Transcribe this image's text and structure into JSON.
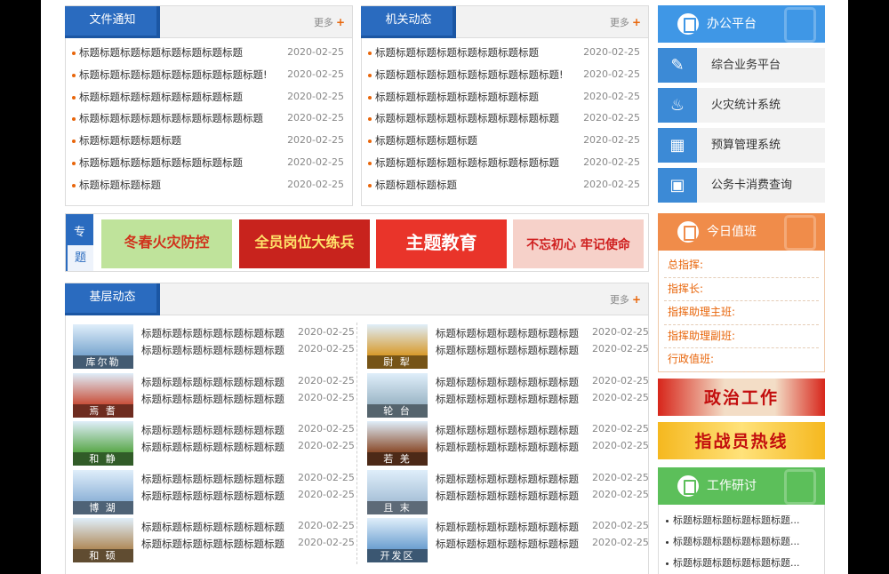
{
  "notice": {
    "tab": "文件通知",
    "more": "更多",
    "items": [
      {
        "title": "标题标题标题标题标题标题标题标题",
        "date": "2020-02-25"
      },
      {
        "title": "标题标题标题标题标题标题标题标题标题!",
        "date": "2020-02-25"
      },
      {
        "title": "标题标题标题标题标题标题标题标题",
        "date": "2020-02-25"
      },
      {
        "title": "标题标题标题标题标题标题标题标题标题",
        "date": "2020-02-25"
      },
      {
        "title": "标题标题标题标题标题",
        "date": "2020-02-25"
      },
      {
        "title": "标题标题标题标题标题标题标题标题",
        "date": "2020-02-25"
      },
      {
        "title": "标题标题标题标题",
        "date": "2020-02-25"
      }
    ]
  },
  "org_news": {
    "tab": "机关动态",
    "more": "更多",
    "items": [
      {
        "title": "标题标题标题标题标题标题标题标题",
        "date": "2020-02-25"
      },
      {
        "title": "标题标题标题标题标题标题标题标题标题!",
        "date": "2020-02-25"
      },
      {
        "title": "标题标题标题标题标题标题标题标题",
        "date": "2020-02-25"
      },
      {
        "title": "标题标题标题标题标题标题标题标题标题",
        "date": "2020-02-25"
      },
      {
        "title": "标题标题标题标题标题",
        "date": "2020-02-25"
      },
      {
        "title": "标题标题标题标题标题标题标题标题标题",
        "date": "2020-02-25"
      },
      {
        "title": "标题标题标题标题",
        "date": "2020-02-25"
      }
    ]
  },
  "topics": {
    "label_1": "专",
    "label_2": "题",
    "banners": [
      {
        "text": "冬春火灾防控",
        "bg": "#bfe39b",
        "color": "#d0321c"
      },
      {
        "text": "全员岗位大练兵",
        "bg": "#c8231d",
        "color": "#ffe36a"
      },
      {
        "text": "主题教育",
        "bg": "#e9342a",
        "color": "#ffffff"
      },
      {
        "text": "不忘初心 牢记使命",
        "bg": "#f6d1c9",
        "color": "#cf1f1f"
      }
    ]
  },
  "grassroots": {
    "tab": "基层动态",
    "more": "更多",
    "items": [
      {
        "caption": "库尔勒",
        "bg": "#7aa6cf",
        "rows": [
          {
            "title": "标题标题标题标题标题标题标题",
            "date": "2020-02-25"
          },
          {
            "title": "标题标题标题标题标题标题标题",
            "date": "2020-02-25"
          }
        ]
      },
      {
        "caption": "尉 犁",
        "bg": "#d89a2b",
        "rows": [
          {
            "title": "标题标题标题标题标题标题标题",
            "date": "2020-02-25"
          },
          {
            "title": "标题标题标题标题标题标题标题",
            "date": "2020-02-25"
          }
        ]
      },
      {
        "caption": "焉 耆",
        "bg": "#c9503b",
        "rows": [
          {
            "title": "标题标题标题标题标题标题标题",
            "date": "2020-02-25"
          },
          {
            "title": "标题标题标题标题标题标题标题",
            "date": "2020-02-25"
          }
        ]
      },
      {
        "caption": "轮 台",
        "bg": "#9cb6c6",
        "rows": [
          {
            "title": "标题标题标题标题标题标题标题",
            "date": "2020-02-25"
          },
          {
            "title": "标题标题标题标题标题标题标题",
            "date": "2020-02-25"
          }
        ]
      },
      {
        "caption": "和 静",
        "bg": "#5aa84a",
        "rows": [
          {
            "title": "标题标题标题标题标题标题标题",
            "date": "2020-02-25"
          },
          {
            "title": "标题标题标题标题标题标题标题",
            "date": "2020-02-25"
          }
        ]
      },
      {
        "caption": "若 羌",
        "bg": "#8a4b2a",
        "rows": [
          {
            "title": "标题标题标题标题标题标题标题",
            "date": "2020-02-25"
          },
          {
            "title": "标题标题标题标题标题标题标题",
            "date": "2020-02-25"
          }
        ]
      },
      {
        "caption": "博 湖",
        "bg": "#8fb3d8",
        "rows": [
          {
            "title": "标题标题标题标题标题标题标题",
            "date": "2020-02-25"
          },
          {
            "title": "标题标题标题标题标题标题标题",
            "date": "2020-02-25"
          }
        ]
      },
      {
        "caption": "且 末",
        "bg": "#a9c2d9",
        "rows": [
          {
            "title": "标题标题标题标题标题标题标题",
            "date": "2020-02-25"
          },
          {
            "title": "标题标题标题标题标题标题标题",
            "date": "2020-02-25"
          }
        ]
      },
      {
        "caption": "和 硕",
        "bg": "#b08a5a",
        "rows": [
          {
            "title": "标题标题标题标题标题标题标题",
            "date": "2020-02-25"
          },
          {
            "title": "标题标题标题标题标题标题标题",
            "date": "2020-02-25"
          }
        ]
      },
      {
        "caption": "开发区",
        "bg": "#6c9fd0",
        "rows": [
          {
            "title": "标题标题标题标题标题标题标题",
            "date": "2020-02-25"
          },
          {
            "title": "标题标题标题标题标题标题标题",
            "date": "2020-02-25"
          }
        ]
      }
    ]
  },
  "office": {
    "title": "办公平台",
    "color": "#3f97e6",
    "systems": [
      {
        "label": "综合业务平台",
        "icon": "edit-document-icon",
        "glyph": "✎"
      },
      {
        "label": "火灾统计系统",
        "icon": "fire-extinguisher-icon",
        "glyph": "♨"
      },
      {
        "label": "预算管理系统",
        "icon": "stamp-icon",
        "glyph": "▦"
      },
      {
        "label": "公务卡消费查询",
        "icon": "card-screen-icon",
        "glyph": "▣"
      }
    ]
  },
  "duty": {
    "title": "今日值班",
    "color": "#f08c4a",
    "rows": [
      "总指挥:",
      "指挥长:",
      "指挥助理主班:",
      "指挥助理副班:",
      "行政值班:"
    ]
  },
  "side_banners": [
    {
      "text": "政治工作",
      "bg": "#e24a2c"
    },
    {
      "text": "指战员热线",
      "bg": "#f3c12a"
    }
  ],
  "research": {
    "title": "工作研讨",
    "color": "#5cbf5a",
    "items": [
      "标题标题标题标题标题标题...",
      "标题标题标题标题标题标题...",
      "标题标题标题标题标题标题..."
    ]
  }
}
